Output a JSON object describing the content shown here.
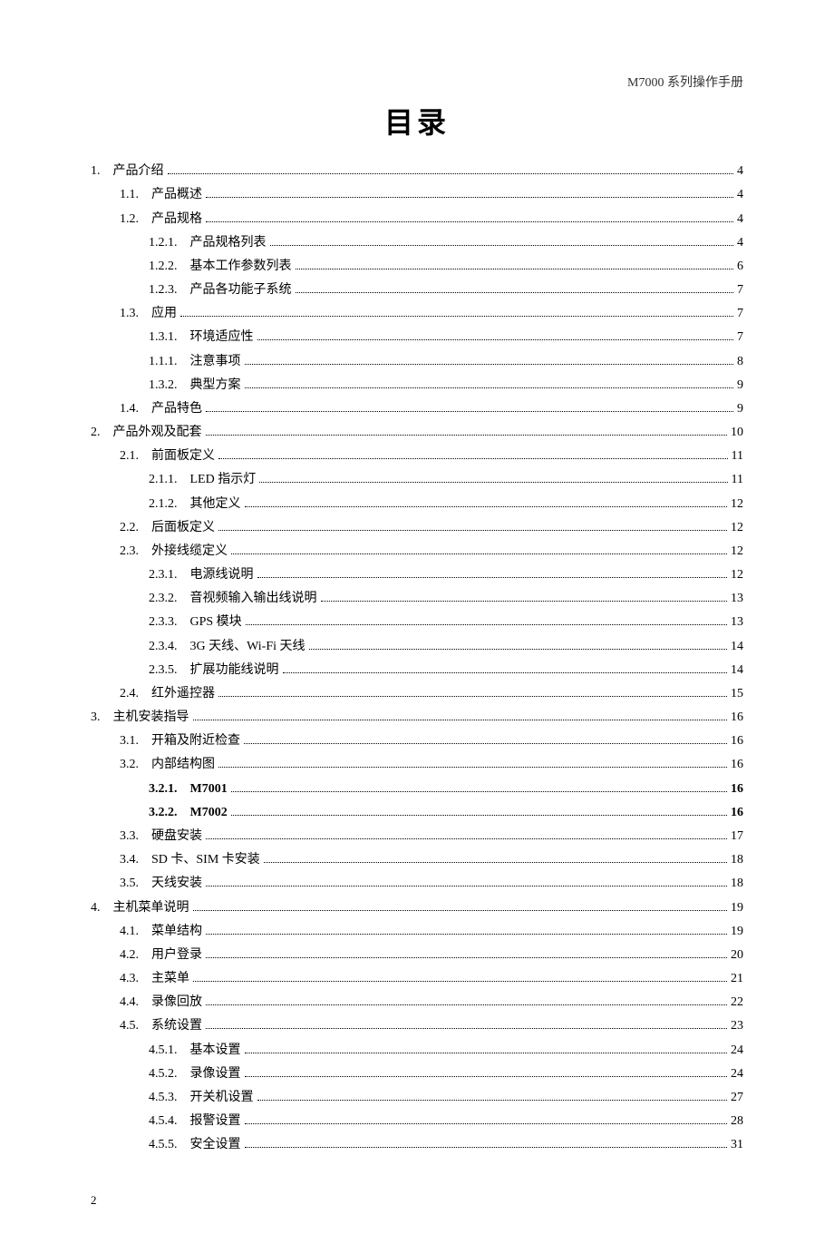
{
  "header": "M7000 系列操作手册",
  "title": "目录",
  "footer_page": "2",
  "toc": [
    {
      "indent": 0,
      "num": "1.",
      "label": "产品介绍",
      "page": "4",
      "bold": false
    },
    {
      "indent": 1,
      "num": "1.1.",
      "label": "产品概述",
      "page": "4",
      "bold": false
    },
    {
      "indent": 1,
      "num": "1.2.",
      "label": "产品规格",
      "page": "4",
      "bold": false
    },
    {
      "indent": 2,
      "num": "1.2.1.",
      "label": "产品规格列表",
      "page": "4",
      "bold": false
    },
    {
      "indent": 2,
      "num": "1.2.2.",
      "label": "基本工作参数列表",
      "page": "6",
      "bold": false
    },
    {
      "indent": 2,
      "num": "1.2.3.",
      "label": "产品各功能子系统",
      "page": "7",
      "bold": false
    },
    {
      "indent": 1,
      "num": "1.3.",
      "label": "应用",
      "page": "7",
      "bold": false
    },
    {
      "indent": 2,
      "num": "1.3.1.",
      "label": "环境适应性",
      "page": "7",
      "bold": false
    },
    {
      "indent": 2,
      "num": "1.1.1.",
      "label": "注意事项",
      "page": "8",
      "bold": false
    },
    {
      "indent": 2,
      "num": "1.3.2.",
      "label": "典型方案",
      "page": "9",
      "bold": false
    },
    {
      "indent": 1,
      "num": "1.4.",
      "label": "产品特色",
      "page": "9",
      "bold": false
    },
    {
      "indent": 0,
      "num": "2.",
      "label": "产品外观及配套",
      "page": "10",
      "bold": false
    },
    {
      "indent": 1,
      "num": "2.1.",
      "label": "前面板定义",
      "page": "11",
      "bold": false
    },
    {
      "indent": 2,
      "num": "2.1.1.",
      "label": "LED 指示灯",
      "page": "11",
      "bold": false
    },
    {
      "indent": 2,
      "num": "2.1.2.",
      "label": "其他定义",
      "page": "12",
      "bold": false
    },
    {
      "indent": 1,
      "num": "2.2.",
      "label": "后面板定义",
      "page": "12",
      "bold": false
    },
    {
      "indent": 1,
      "num": "2.3.",
      "label": "外接线缆定义",
      "page": "12",
      "bold": false
    },
    {
      "indent": 2,
      "num": "2.3.1.",
      "label": "电源线说明",
      "page": "12",
      "bold": false
    },
    {
      "indent": 2,
      "num": "2.3.2.",
      "label": "音视频输入输出线说明",
      "page": "13",
      "bold": false
    },
    {
      "indent": 2,
      "num": "2.3.3.",
      "label": "GPS 模块",
      "page": "13",
      "bold": false
    },
    {
      "indent": 2,
      "num": "2.3.4.",
      "label": "3G 天线、Wi-Fi 天线",
      "page": "14",
      "bold": false
    },
    {
      "indent": 2,
      "num": "2.3.5.",
      "label": "扩展功能线说明",
      "page": "14",
      "bold": false
    },
    {
      "indent": 1,
      "num": "2.4.",
      "label": "红外遥控器",
      "page": "15",
      "bold": false
    },
    {
      "indent": 0,
      "num": "3.",
      "label": "主机安装指导",
      "page": "16",
      "bold": false
    },
    {
      "indent": 1,
      "num": "3.1.",
      "label": "开箱及附近检查",
      "page": "16",
      "bold": false
    },
    {
      "indent": 1,
      "num": "3.2.",
      "label": "内部结构图",
      "page": "16",
      "bold": false
    },
    {
      "indent": 2,
      "num": "3.2.1.",
      "label": "M7001",
      "page": "16",
      "bold": true
    },
    {
      "indent": 2,
      "num": "3.2.2.",
      "label": "M7002",
      "page": "16",
      "bold": true
    },
    {
      "indent": 1,
      "num": "3.3.",
      "label": "硬盘安装",
      "page": "17",
      "bold": false
    },
    {
      "indent": 1,
      "num": "3.4.",
      "label": "SD 卡、SIM 卡安装",
      "page": "18",
      "bold": false
    },
    {
      "indent": 1,
      "num": "3.5.",
      "label": "天线安装",
      "page": "18",
      "bold": false
    },
    {
      "indent": 0,
      "num": "4.",
      "label": "主机菜单说明",
      "page": "19",
      "bold": false
    },
    {
      "indent": 1,
      "num": "4.1.",
      "label": "菜单结构",
      "page": "19",
      "bold": false
    },
    {
      "indent": 1,
      "num": "4.2.",
      "label": "用户登录",
      "page": "20",
      "bold": false
    },
    {
      "indent": 1,
      "num": "4.3.",
      "label": "主菜单",
      "page": "21",
      "bold": false
    },
    {
      "indent": 1,
      "num": "4.4.",
      "label": "录像回放",
      "page": "22",
      "bold": false
    },
    {
      "indent": 1,
      "num": "4.5.",
      "label": "系统设置",
      "page": "23",
      "bold": false
    },
    {
      "indent": 2,
      "num": "4.5.1.",
      "label": "基本设置",
      "page": "24",
      "bold": false
    },
    {
      "indent": 2,
      "num": "4.5.2.",
      "label": "录像设置",
      "page": "24",
      "bold": false
    },
    {
      "indent": 2,
      "num": "4.5.3.",
      "label": "开关机设置",
      "page": "27",
      "bold": false
    },
    {
      "indent": 2,
      "num": "4.5.4.",
      "label": "报警设置",
      "page": "28",
      "bold": false
    },
    {
      "indent": 2,
      "num": "4.5.5.",
      "label": "安全设置",
      "page": "31",
      "bold": false
    }
  ]
}
